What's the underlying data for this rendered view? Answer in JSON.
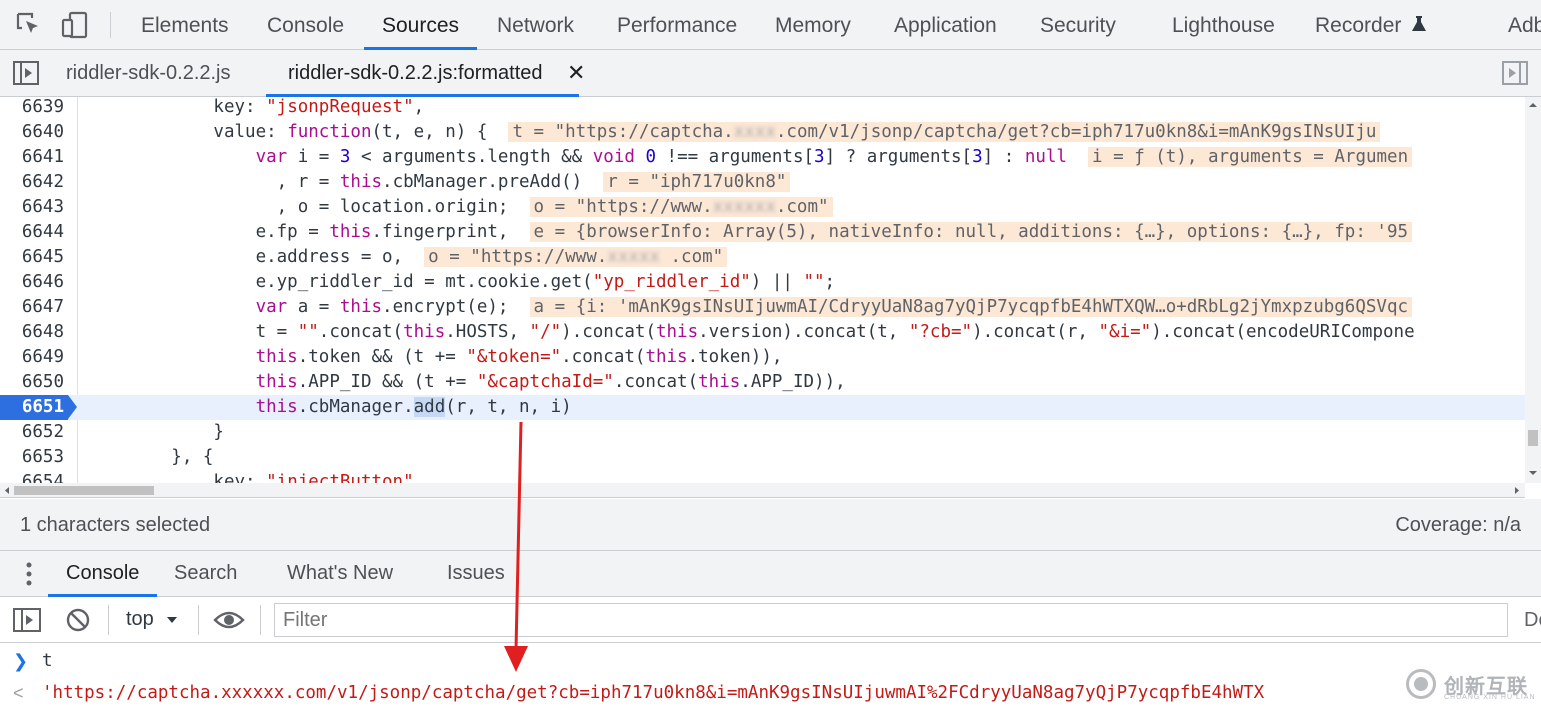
{
  "toolbar": {
    "tabs": [
      "Elements",
      "Console",
      "Sources",
      "Network",
      "Performance",
      "Memory",
      "Application",
      "Security",
      "Lighthouse",
      "Recorder",
      "Adbloc"
    ],
    "active": "Sources"
  },
  "files": {
    "tabs": [
      "riddler-sdk-0.2.2.js",
      "riddler-sdk-0.2.2.js:formatted"
    ],
    "close_glyph": "✕"
  },
  "editor": {
    "lines": [
      {
        "n": "6639",
        "html": "            key: <span class='str'>\"jsonpRequest\"</span>,"
      },
      {
        "n": "6640",
        "html": "            value: <span class='kw'>function</span>(t, e, n) {  <span class='inline-val'>t = \"https://captcha.<span class='blur'>xxxx</span>.com/v1/jsonp/captcha/get?cb=iph717u0kn8&i=mAnK9gsINsUIju</span>"
      },
      {
        "n": "6641",
        "html": "                <span class='kw'>var</span> i = <span class='num'>3</span> &lt; arguments.length &amp;&amp; <span class='kw'>void</span> <span class='num'>0</span> !== arguments[<span class='num'>3</span>] ? arguments[<span class='num'>3</span>] : <span class='kw'>null</span>  <span class='inline-val'>i = ƒ (t), arguments = Argumen</span>"
      },
      {
        "n": "6642",
        "html": "                  , r = <span class='kw'>this</span>.cbManager.preAdd()  <span class='inline-val'>r = \"iph717u0kn8\"</span>"
      },
      {
        "n": "6643",
        "html": "                  , o = location.origin;  <span class='inline-val'>o = \"https://www.<span class='blur'>xxxxxx</span>.com\"</span>"
      },
      {
        "n": "6644",
        "html": "                e.fp = <span class='kw'>this</span>.fingerprint,  <span class='inline-val'>e = {browserInfo: Array(5), nativeInfo: null, additions: {…}, options: {…}, fp: '95</span>"
      },
      {
        "n": "6645",
        "html": "                e.address = o,  <span class='inline-val'>o = \"https://www.<span class='blur'>xxxxx</span> .com\"</span>"
      },
      {
        "n": "6646",
        "html": "                e.yp_riddler_id = mt.cookie.get(<span class='str'>\"yp_riddler_id\"</span>) || <span class='str'>\"\"</span>;"
      },
      {
        "n": "6647",
        "html": "                <span class='kw'>var</span> a = <span class='kw'>this</span>.encrypt(e);  <span class='inline-val'>a = {i: 'mAnK9gsINsUIjuwmAI/CdryyUaN8ag7yQjP7ycqpfbE4hWTXQW…o+dRbLg2jYmxpzubg6QSVqc</span>"
      },
      {
        "n": "6648",
        "html": "                t = <span class='str'>\"\"</span>.concat(<span class='kw'>this</span>.HOSTS, <span class='str'>\"/\"</span>).concat(<span class='kw'>this</span>.version).concat(t, <span class='str'>\"?cb=\"</span>).concat(r, <span class='str'>\"&amp;i=\"</span>).concat(encodeURICompone"
      },
      {
        "n": "6649",
        "html": "                <span class='kw'>this</span>.token &amp;&amp; (t += <span class='str'>\"&amp;token=\"</span>.concat(<span class='kw'>this</span>.token)),"
      },
      {
        "n": "6650",
        "html": "                <span class='kw'>this</span>.APP_ID &amp;&amp; (t += <span class='str'>\"&amp;captchaId=\"</span>.concat(<span class='kw'>this</span>.APP_ID)),"
      },
      {
        "n": "6651",
        "html": "                <span class='kw'>this</span>.cbManager.<span class='sel'>add</span>(r, t, n, i)",
        "current": true
      },
      {
        "n": "6652",
        "html": "            }"
      },
      {
        "n": "6653",
        "html": "        }, {"
      },
      {
        "n": "6654",
        "html": "            key: <span class='str'>\"injectButton\"</span>,"
      }
    ]
  },
  "status": {
    "selection": "1 characters selected",
    "coverage": "Coverage: n/a"
  },
  "drawer": {
    "tabs": [
      "Console",
      "Search",
      "What's New",
      "Issues"
    ],
    "active": "Console"
  },
  "console": {
    "context": "top",
    "filter_placeholder": "Filter",
    "right_text": "De",
    "input": "t",
    "result": "'https://captcha.xxxxxx.com/v1/jsonp/captcha/get?cb=iph717u0kn8&i=mAnK9gsINsUIjuwmAI%2FCdryyUaN8ag7yQjP7ycqpfbE4hWTX",
    "prompt_glyph": "❯",
    "result_glyph": "<"
  },
  "watermark": {
    "text": "创新互联",
    "sub": "CHUANG XIN HU LIAN"
  },
  "colors": {
    "accent": "#1a73e8",
    "current_line": "#2d6fe0",
    "arrow": "#e02020"
  }
}
